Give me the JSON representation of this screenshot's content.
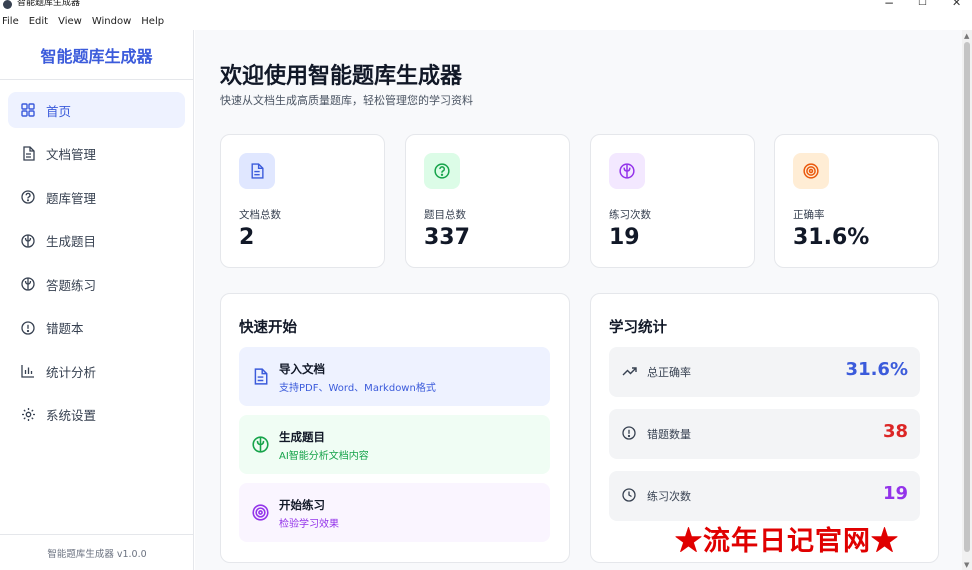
{
  "window": {
    "title": "智能题库生成器",
    "minimize": "−",
    "maximize": "☐",
    "close": "✕"
  },
  "menu": [
    "File",
    "Edit",
    "View",
    "Window",
    "Help"
  ],
  "sidebar": {
    "brand": "智能题库生成器",
    "items": [
      {
        "label": "首页",
        "icon": "grid-icon",
        "active": true
      },
      {
        "label": "文档管理",
        "icon": "document-icon"
      },
      {
        "label": "题库管理",
        "icon": "question-icon"
      },
      {
        "label": "生成题目",
        "icon": "brain-icon"
      },
      {
        "label": "答题练习",
        "icon": "brain-icon"
      },
      {
        "label": "错题本",
        "icon": "alert-circle-icon"
      },
      {
        "label": "统计分析",
        "icon": "bar-chart-icon"
      },
      {
        "label": "系统设置",
        "icon": "gear-icon"
      }
    ],
    "footer": "智能题库生成器 v1.0.0"
  },
  "header": {
    "title": "欢迎使用智能题库生成器",
    "subtitle": "快速从文档生成高质量题库，轻松管理您的学习资料"
  },
  "stats": [
    {
      "label": "文档总数",
      "value": "2",
      "icon": "document-icon",
      "bg": "#e0e7ff",
      "fg": "#3b5bdb"
    },
    {
      "label": "题目总数",
      "value": "337",
      "icon": "question-icon",
      "bg": "#dcfce7",
      "fg": "#16a34a"
    },
    {
      "label": "练习次数",
      "value": "19",
      "icon": "brain-icon",
      "bg": "#f3e8ff",
      "fg": "#9333ea"
    },
    {
      "label": "正确率",
      "value": "31.6%",
      "icon": "target-icon",
      "bg": "#ffedd5",
      "fg": "#ea580c"
    }
  ],
  "quick_start": {
    "title": "快速开始",
    "items": [
      {
        "title": "导入文档",
        "desc": "支持PDF、Word、Markdown格式",
        "icon": "document-icon",
        "bg": "#eef2ff",
        "fg": "#3b5bdb"
      },
      {
        "title": "生成题目",
        "desc": "AI智能分析文档内容",
        "icon": "brain-icon",
        "bg": "#f0fdf4",
        "fg": "#16a34a"
      },
      {
        "title": "开始练习",
        "desc": "检验学习效果",
        "icon": "target-icon",
        "bg": "#faf5ff",
        "fg": "#9333ea"
      }
    ]
  },
  "study_stats": {
    "title": "学习统计",
    "rows": [
      {
        "label": "总正确率",
        "value": "31.6%",
        "icon": "trending-up-icon",
        "color": "#3b5bdb"
      },
      {
        "label": "错题数量",
        "value": "38",
        "icon": "alert-circle-icon",
        "color": "#dc2626"
      },
      {
        "label": "练习次数",
        "value": "19",
        "icon": "clock-icon",
        "color": "#9333ea"
      }
    ]
  },
  "watermark": "★流年日记官网★"
}
